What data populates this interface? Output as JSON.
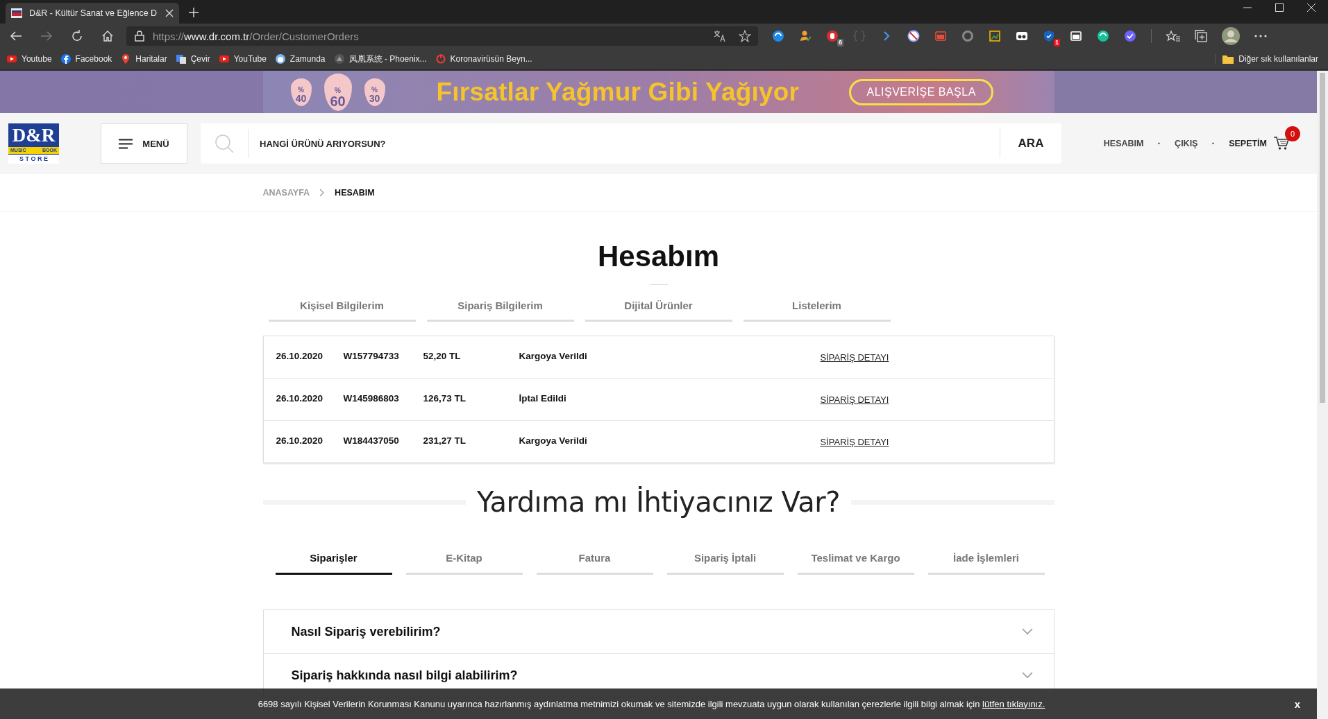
{
  "browser": {
    "tab_title": "D&R - Kültür Sanat ve Eğlence D",
    "url": {
      "scheme": "https://",
      "host": "www.dr.com.tr",
      "path": "/Order/CustomerOrders"
    },
    "extension_badges": [
      "6",
      "1"
    ],
    "bookmarks": [
      "Youtube",
      "Facebook",
      "Haritalar",
      "Çevir",
      "YouTube",
      "Zamunda",
      "凤凰系统 - Phoenix...",
      "Koronavirüsün Beyn..."
    ],
    "other_bookmarks": "Diğer sık kullanılanlar"
  },
  "banner": {
    "drops": [
      {
        "sign": "%",
        "value": "40"
      },
      {
        "sign": "%",
        "value": "60"
      },
      {
        "sign": "%",
        "value": "30"
      }
    ],
    "headline": "Fırsatlar Yağmur Gibi Yağıyor",
    "button": "ALIŞVERİŞE BAŞLA"
  },
  "header": {
    "logo": {
      "main": "D&R",
      "left": "MUSIC",
      "right": "BOOK",
      "bottom": "S T O R E"
    },
    "menu": "MENÜ",
    "search": {
      "placeholder": "HANGİ ÜRÜNÜ ARIYORSUN?",
      "button": "ARA"
    },
    "links": [
      "HESABIM",
      "ÇIKIŞ"
    ],
    "separator": "·",
    "cart": {
      "label": "SEPETİM",
      "count": "0"
    }
  },
  "breadcrumb": [
    {
      "label": "ANASAYFA",
      "current": false
    },
    {
      "label": "HESABIM",
      "current": true
    }
  ],
  "title": "Hesabım",
  "account_tabs": [
    {
      "label": "Kişisel Bilgilerim",
      "selected": false
    },
    {
      "label": "Sipariş Bilgilerim",
      "selected": false
    },
    {
      "label": "Dijital Ürünler",
      "selected": false
    },
    {
      "label": "Listelerim",
      "selected": false
    }
  ],
  "orders": [
    {
      "date": "26.10.2020",
      "number": "W157794733",
      "amount": "52,20 TL",
      "status": "Kargoya Verildi",
      "link": "SİPARİŞ DETAYI"
    },
    {
      "date": "26.10.2020",
      "number": "W145986803",
      "amount": "126,73 TL",
      "status": "İptal Edildi",
      "link": "SİPARİŞ DETAYI"
    },
    {
      "date": "26.10.2020",
      "number": "W184437050",
      "amount": "231,27 TL",
      "status": "Kargoya Verildi",
      "link": "SİPARİŞ DETAYI"
    }
  ],
  "help": {
    "heading": "Yardıma mı İhtiyacınız Var?",
    "tabs": [
      {
        "label": "Siparişler",
        "selected": true
      },
      {
        "label": "E-Kitap",
        "selected": false
      },
      {
        "label": "Fatura",
        "selected": false
      },
      {
        "label": "Sipariş İptali",
        "selected": false
      },
      {
        "label": "Teslimat ve Kargo",
        "selected": false
      },
      {
        "label": "İade İşlemleri",
        "selected": false
      }
    ],
    "faq": [
      {
        "question": "Nasıl Sipariş verebilirim?",
        "expanded": false
      },
      {
        "question": "Sipariş hakkında nasıl bilgi alabilirim?",
        "expanded": false
      }
    ]
  },
  "cookie_bar": {
    "text": "6698 sayılı Kişisel Verilerin Korunması Kanunu uyarınca hazırlanmış aydınlatma metnimizi okumak ve sitemizde ilgili mevzuata uygun olarak kullanılan çerezlerle ilgili bilgi almak için",
    "link": "lütfen tıklayınız.",
    "close": "x"
  }
}
